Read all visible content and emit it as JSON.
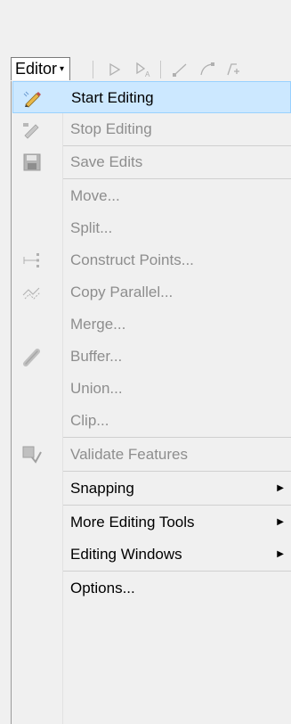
{
  "toolbar": {
    "editor_label": "Editor",
    "editor_caret": "▾"
  },
  "menu": {
    "items": [
      {
        "label": "Start Editing",
        "enabled": true,
        "highlight": true,
        "icon": "pencil-edit-icon"
      },
      {
        "label": "Stop Editing",
        "enabled": false,
        "icon": "pencil-stop-icon"
      },
      {
        "label": "Save Edits",
        "enabled": false,
        "icon": "save-disk-icon"
      },
      {
        "label": "Move...",
        "enabled": false
      },
      {
        "label": "Split...",
        "enabled": false
      },
      {
        "label": "Construct Points...",
        "enabled": false,
        "icon": "construct-points-icon"
      },
      {
        "label": "Copy Parallel...",
        "enabled": false,
        "icon": "copy-parallel-icon"
      },
      {
        "label": "Merge...",
        "enabled": false
      },
      {
        "label": "Buffer...",
        "enabled": false,
        "icon": "buffer-icon"
      },
      {
        "label": "Union...",
        "enabled": false
      },
      {
        "label": "Clip...",
        "enabled": false
      },
      {
        "label": "Validate Features",
        "enabled": false,
        "icon": "validate-features-icon"
      },
      {
        "label": "Snapping",
        "enabled": true,
        "submenu": true
      },
      {
        "label": "More Editing Tools",
        "enabled": true,
        "submenu": true
      },
      {
        "label": "Editing Windows",
        "enabled": true,
        "submenu": true
      },
      {
        "label": "Options...",
        "enabled": true
      }
    ],
    "submenu_arrow": "▶"
  },
  "colors": {
    "highlight_bg": "#cce8ff",
    "highlight_border": "#99d1ff",
    "disabled_text": "#6d6d6d",
    "menu_bg": "#f0f0f0"
  }
}
